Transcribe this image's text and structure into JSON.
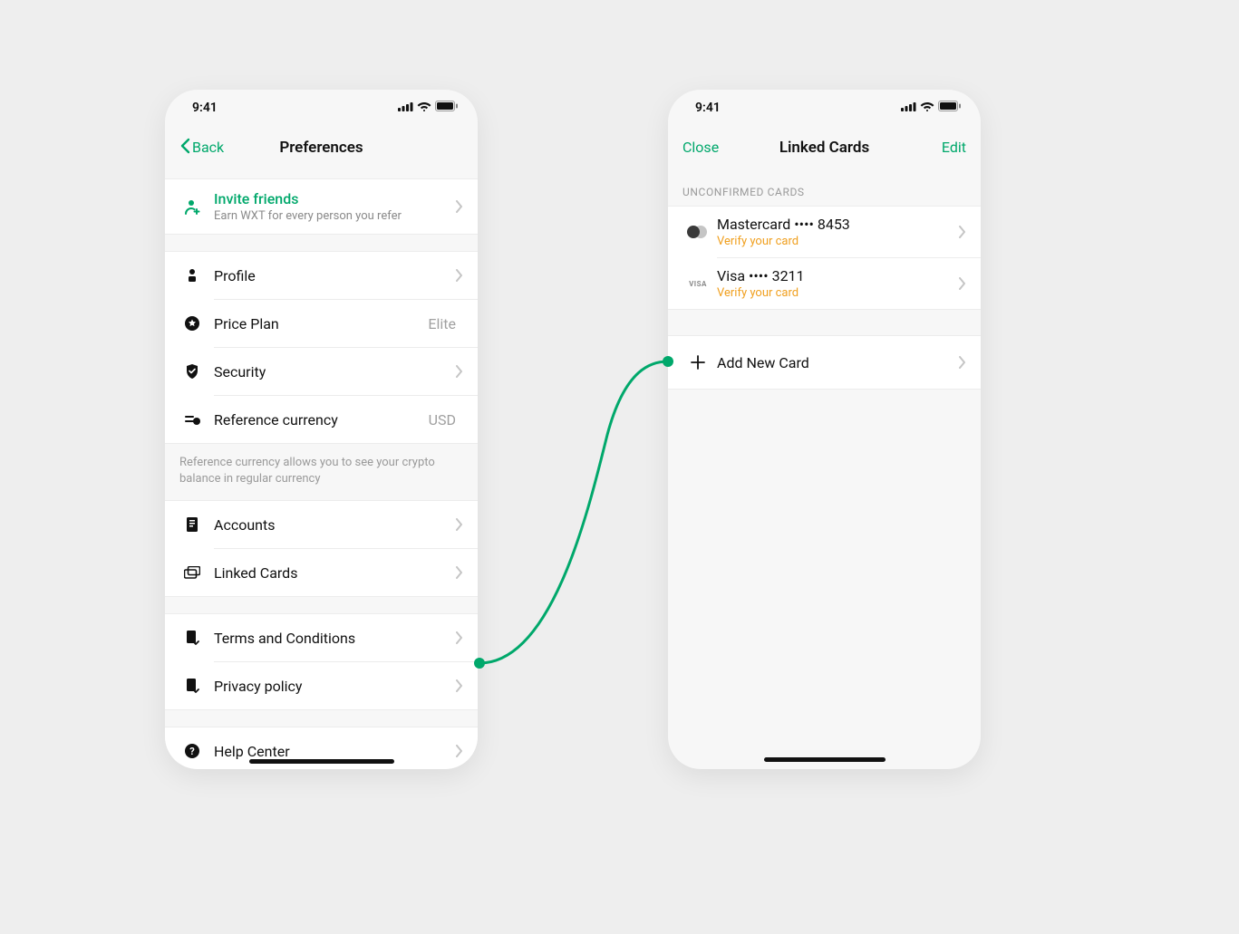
{
  "colors": {
    "accent": "#00a86b",
    "warn": "#f0a020"
  },
  "status": {
    "time": "9:41"
  },
  "left": {
    "nav": {
      "back_label": "Back",
      "title": "Preferences"
    },
    "invite": {
      "title": "Invite friends",
      "sub": "Earn WXT for every person you refer"
    },
    "rows": {
      "profile": "Profile",
      "price_plan": "Price Plan",
      "price_plan_value": "Elite",
      "security": "Security",
      "ref_currency": "Reference currency",
      "ref_currency_value": "USD",
      "accounts": "Accounts",
      "linked_cards": "Linked Cards",
      "terms": "Terms and Conditions",
      "privacy": "Privacy policy",
      "help": "Help Center"
    },
    "footnote": "Reference currency allows you to see your crypto balance in regular currency"
  },
  "right": {
    "nav": {
      "close_label": "Close",
      "title": "Linked Cards",
      "edit_label": "Edit"
    },
    "section_header": "Unconfirmed Cards",
    "cards": [
      {
        "brand": "mastercard",
        "title": "Mastercard •••• 8453",
        "sub": "Verify your card"
      },
      {
        "brand": "visa",
        "title": "Visa •••• 3211",
        "sub": "Verify your card"
      }
    ],
    "add_new": "Add New Card",
    "visa_brand_text": "VISA"
  }
}
